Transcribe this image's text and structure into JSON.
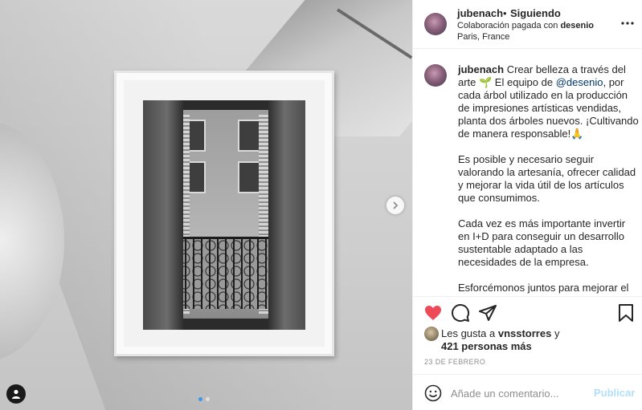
{
  "post": {
    "username": "jubenach",
    "follow_status": "Siguiendo",
    "bullet": "•",
    "collab_prefix": "Colaboración pagada con",
    "collab_partner": "desenio",
    "location": "Paris, France"
  },
  "caption": {
    "username": "jubenach",
    "p1_a": "Crear belleza a través del arte 🌱 El equipo de ",
    "mention": "@desenio",
    "p1_b": ", por cada árbol utilizado en la producción de impresiones artísticas vendidas, planta dos árboles nuevos. ¡Cultivando de manera responsable!🙏",
    "p2": "Es posible y necesario seguir valorando la artesanía, ofrecer calidad y mejorar la vida útil de los artículos que consumimos.",
    "p3": "Cada vez es más importante invertir en I+D para conseguir un desarrollo sustentable adaptado a las necesidades de la empresa.",
    "p4": "Esforcémonos juntos para mejorar el proceso de producción (cada uno en su"
  },
  "likes": {
    "prefix": "Les gusta a",
    "user": "vnsstorres",
    "conj": "y",
    "others": "421 personas más"
  },
  "date": "23 DE FEBRERO",
  "comment": {
    "placeholder": "Añade un comentario...",
    "post_label": "Publicar"
  },
  "carousel": {
    "current": 1,
    "total": 2
  },
  "colors": {
    "like_red": "#ed4956",
    "link_blue": "#00376b",
    "post_disabled": "#b2dffc",
    "dot_active": "#3897f0"
  },
  "icons": [
    "more-icon",
    "heart-icon",
    "comment-icon",
    "share-icon",
    "bookmark-icon",
    "emoji-icon",
    "next-arrow-icon",
    "user-tag-icon"
  ]
}
